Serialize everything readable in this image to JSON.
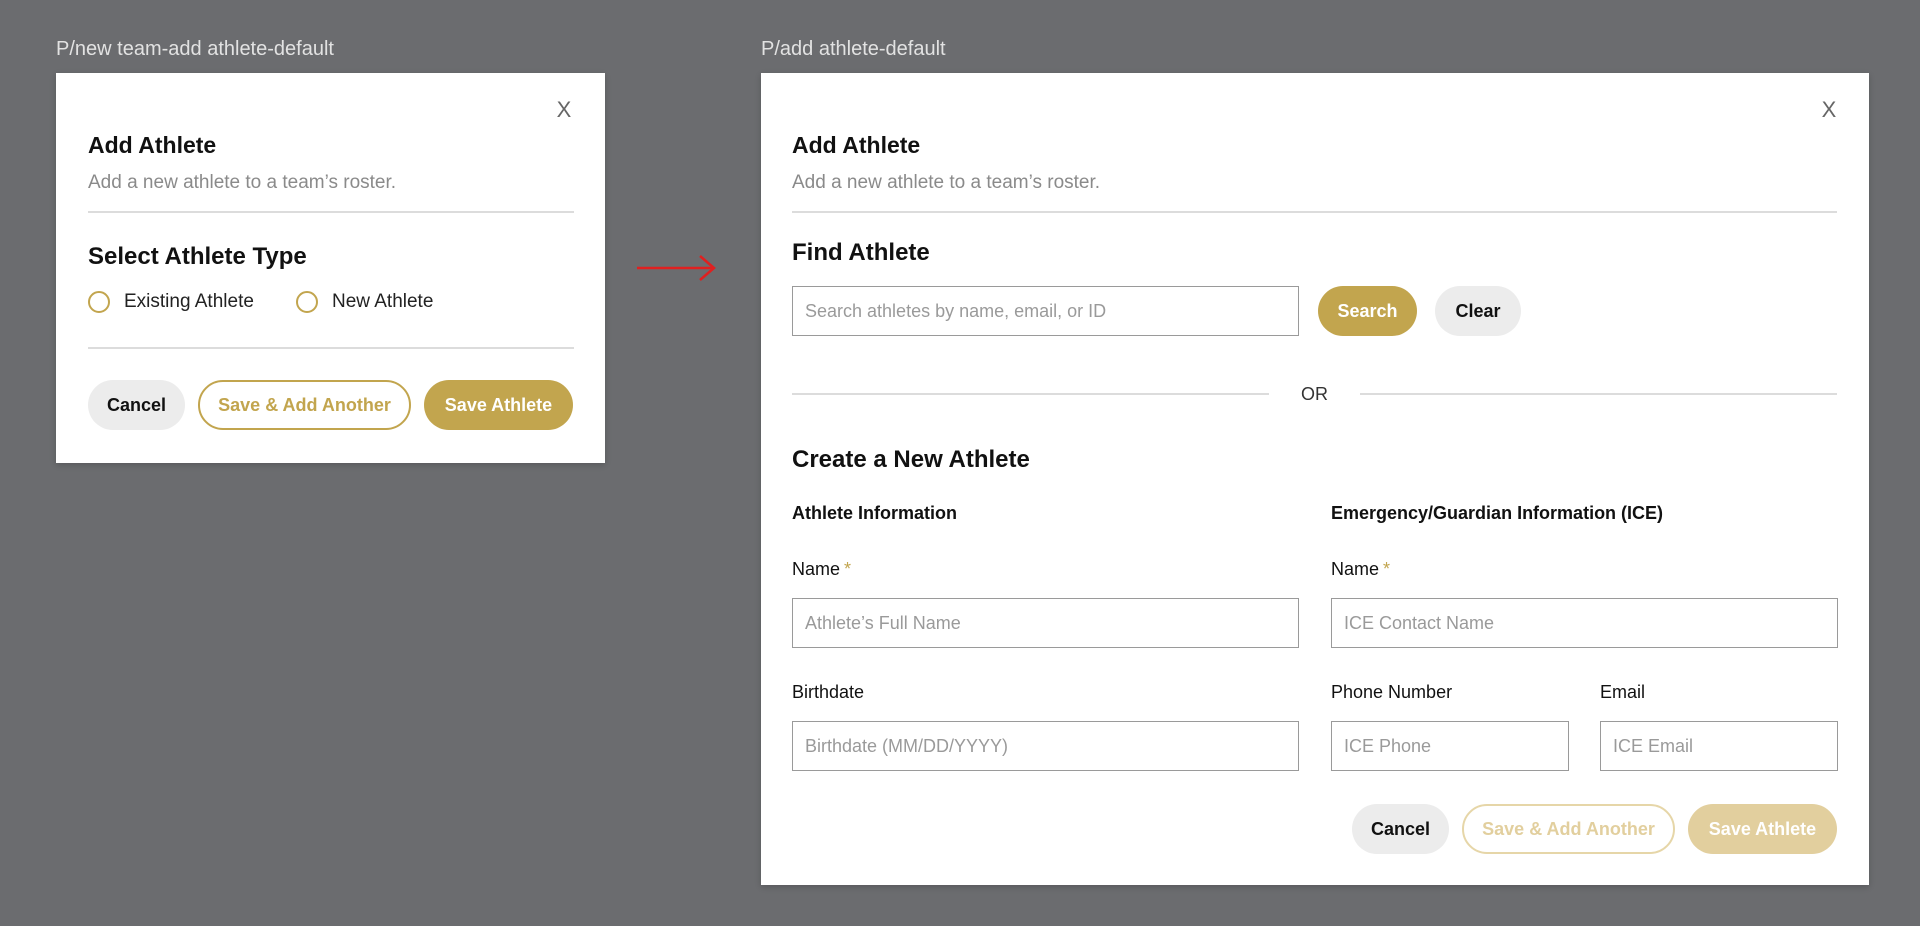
{
  "frames": {
    "left_label": "P/new team-add athlete-default",
    "right_label": "P/add athlete-default"
  },
  "left_modal": {
    "close": "X",
    "title": "Add Athlete",
    "subtitle": "Add a new athlete to a team’s roster.",
    "section_title": "Select Athlete Type",
    "options": [
      "Existing Athlete",
      "New Athlete"
    ],
    "buttons": {
      "cancel": "Cancel",
      "save_add_another": "Save & Add Another",
      "save": "Save Athlete"
    }
  },
  "right_modal": {
    "close": "X",
    "title": "Add Athlete",
    "subtitle": "Add a new athlete to a team’s roster.",
    "find": {
      "title": "Find Athlete",
      "search_placeholder": "Search athletes by name, email, or ID",
      "search_button": "Search",
      "clear_button": "Clear"
    },
    "or_text": "OR",
    "create": {
      "title": "Create a New Athlete",
      "athlete_info_heading": "Athlete Information",
      "ice_heading": "Emergency/Guardian Information (ICE)",
      "athlete_name_label": "Name",
      "athlete_name_placeholder": "Athlete’s Full Name",
      "birthdate_label": "Birthdate",
      "birthdate_placeholder": "Birthdate (MM/DD/YYYY)",
      "ice_name_label": "Name",
      "ice_name_placeholder": "ICE Contact Name",
      "ice_phone_label": "Phone Number",
      "ice_phone_placeholder": "ICE Phone",
      "ice_email_label": "Email",
      "ice_email_placeholder": "ICE Email",
      "required_marker": "*"
    },
    "buttons": {
      "cancel": "Cancel",
      "save_add_another": "Save & Add Another",
      "save": "Save Athlete"
    }
  },
  "colors": {
    "accent": "#c2a54e",
    "accent_faint": "#e2cf9e",
    "backdrop": "#6b6c6f",
    "arrow": "#e02020"
  },
  "icons": {
    "close": "close-icon",
    "arrow": "arrow-right-icon"
  }
}
